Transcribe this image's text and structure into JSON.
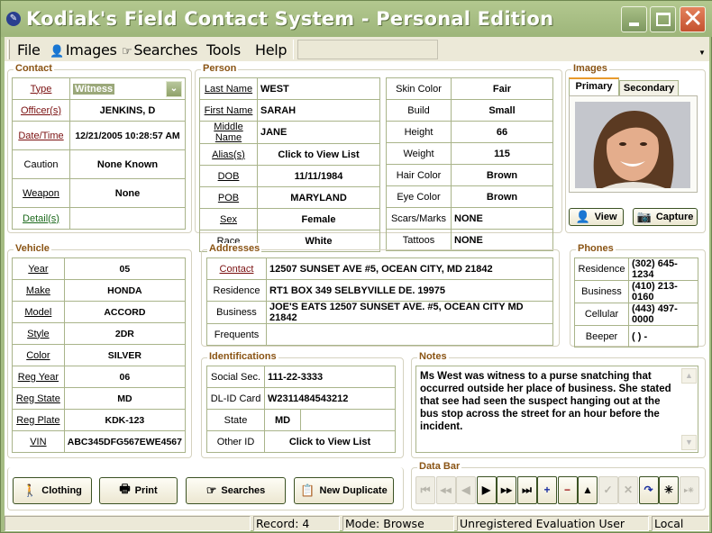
{
  "window": {
    "title": "Kodiak's Field Contact System - Personal Edition",
    "minimize_label": "minimize",
    "maximize_label": "maximize",
    "close_label": "close"
  },
  "menu": {
    "items": [
      {
        "label": "File",
        "icon": ""
      },
      {
        "label": "Images",
        "icon": "person-icon"
      },
      {
        "label": "Searches",
        "icon": "pointing-hand-icon"
      },
      {
        "label": "Tools",
        "icon": ""
      },
      {
        "label": "Help",
        "icon": ""
      }
    ]
  },
  "contact": {
    "title": "Contact",
    "rows": [
      {
        "label": "Type",
        "value": "Witness"
      },
      {
        "label": "Officer(s)",
        "value": "JENKINS, D"
      },
      {
        "label": "Date/Time",
        "value": "12/21/2005 10:28:57 AM"
      },
      {
        "label": "Caution",
        "value": "None Known"
      },
      {
        "label": "Weapon",
        "value": "None"
      },
      {
        "label": "Detail(s)",
        "value": ""
      }
    ]
  },
  "person": {
    "title": "Person",
    "left": [
      {
        "label": "Last Name",
        "value": "WEST"
      },
      {
        "label": "First Name",
        "value": "SARAH"
      },
      {
        "label": "Middle Name",
        "value": "JANE"
      },
      {
        "label": "Alias(s)",
        "value": "Click to View List"
      },
      {
        "label": "DOB",
        "value": "11/11/1984"
      },
      {
        "label": "POB",
        "value": "MARYLAND"
      },
      {
        "label": "Sex",
        "value": "Female"
      },
      {
        "label": "Race",
        "value": "White"
      }
    ],
    "right": [
      {
        "label": "Skin Color",
        "value": "Fair"
      },
      {
        "label": "Build",
        "value": "Small"
      },
      {
        "label": "Height",
        "value": "66"
      },
      {
        "label": "Weight",
        "value": "115"
      },
      {
        "label": "Hair Color",
        "value": "Brown"
      },
      {
        "label": "Eye Color",
        "value": "Brown"
      },
      {
        "label": "Scars/Marks",
        "value": "NONE"
      },
      {
        "label": "Tattoos",
        "value": "NONE"
      }
    ]
  },
  "images": {
    "title": "Images",
    "tabs": [
      "Primary",
      "Secondary"
    ],
    "view_label": "View",
    "capture_label": "Capture"
  },
  "vehicle": {
    "title": "Vehicle",
    "rows": [
      {
        "label": "Year",
        "value": "05"
      },
      {
        "label": "Make",
        "value": "HONDA"
      },
      {
        "label": "Model",
        "value": "ACCORD"
      },
      {
        "label": "Style",
        "value": "2DR"
      },
      {
        "label": "Color",
        "value": "SILVER"
      },
      {
        "label": "Reg Year",
        "value": "06"
      },
      {
        "label": "Reg State",
        "value": "MD"
      },
      {
        "label": "Reg Plate",
        "value": "KDK-123"
      },
      {
        "label": "VIN",
        "value": "ABC345DFG567EWE4567"
      }
    ]
  },
  "addresses": {
    "title": "Addresses",
    "rows": [
      {
        "label": "Contact",
        "value": "12507 SUNSET AVE #5, OCEAN CITY, MD 21842"
      },
      {
        "label": "Residence",
        "value": "RT1 BOX 349 SELBYVILLE DE. 19975"
      },
      {
        "label": "Business",
        "value": "JOE'S EATS 12507 SUNSET AVE. #5, OCEAN CITY MD 21842"
      },
      {
        "label": "Frequents",
        "value": ""
      }
    ]
  },
  "phones": {
    "title": "Phones",
    "rows": [
      {
        "label": "Residence",
        "value": "(302) 645-1234"
      },
      {
        "label": "Business",
        "value": "(410) 213-0160"
      },
      {
        "label": "Cellular",
        "value": "(443) 497-0000"
      },
      {
        "label": "Beeper",
        "value": "(   )    -"
      }
    ]
  },
  "identifications": {
    "title": "Identifications",
    "rows": [
      {
        "label": "Social Sec.",
        "value": "111-22-3333"
      },
      {
        "label": "DL-ID Card",
        "value": "W2311484543212"
      },
      {
        "label": "State",
        "value": "MD"
      },
      {
        "label": "Other ID",
        "value": "Click to View List"
      }
    ]
  },
  "notes": {
    "title": "Notes",
    "text": "Ms West was witness to a purse snatching that occurred outside her place of business. She stated that see had seen the suspect hanging out at the bus stop across the street for an hour before the incident."
  },
  "actions": {
    "clothing": "Clothing",
    "print": "Print",
    "searches": "Searches",
    "new_duplicate": "New Duplicate"
  },
  "databar": {
    "title": "Data Bar",
    "buttons": [
      {
        "name": "first-record",
        "glyph": "⏮",
        "enabled": false
      },
      {
        "name": "previous-page",
        "glyph": "◀◀",
        "enabled": false
      },
      {
        "name": "previous-record",
        "glyph": "◀",
        "enabled": false
      },
      {
        "name": "next-record",
        "glyph": "▶",
        "enabled": true
      },
      {
        "name": "next-page",
        "glyph": "▶▶",
        "enabled": true
      },
      {
        "name": "last-record",
        "glyph": "⏭",
        "enabled": true
      },
      {
        "name": "add-record",
        "glyph": "+",
        "enabled": true
      },
      {
        "name": "delete-record",
        "glyph": "−",
        "enabled": true
      },
      {
        "name": "edit-record",
        "glyph": "▲",
        "enabled": true
      },
      {
        "name": "save-record",
        "glyph": "✓",
        "enabled": false
      },
      {
        "name": "cancel-edit",
        "glyph": "✕",
        "enabled": false
      },
      {
        "name": "refresh",
        "glyph": "↷",
        "enabled": true
      },
      {
        "name": "find",
        "glyph": "✳",
        "enabled": true
      },
      {
        "name": "find-next",
        "glyph": "▸✳",
        "enabled": false
      }
    ]
  },
  "status": {
    "record": "Record: 4",
    "mode": "Mode: Browse",
    "user": "Unregistered Evaluation User",
    "location": "Local"
  }
}
